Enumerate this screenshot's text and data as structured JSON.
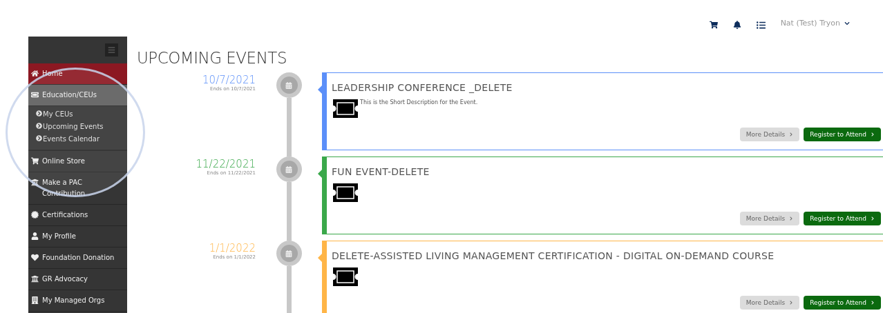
{
  "header": {
    "user": "Nat (Test) Tryon"
  },
  "sidebar": {
    "items": [
      {
        "label": "Home",
        "selected": true,
        "expanded": false
      },
      {
        "label": "Education/CEUs",
        "selected": false,
        "expanded": true,
        "children": [
          {
            "label": "My CEUs"
          },
          {
            "label": "Upcoming Events"
          },
          {
            "label": "Events Calendar"
          }
        ]
      },
      {
        "label": "Online Store",
        "selected": false,
        "expanded": false
      },
      {
        "label": "Make a PAC Contribution",
        "selected": false,
        "expanded": false
      },
      {
        "label": "Certifications",
        "selected": false,
        "expanded": false
      },
      {
        "label": "My Profile",
        "selected": false,
        "expanded": false
      },
      {
        "label": "Foundation Donation",
        "selected": false,
        "expanded": false
      },
      {
        "label": "GR Advocacy",
        "selected": false,
        "expanded": false
      },
      {
        "label": "My Managed Orgs",
        "selected": false,
        "expanded": false
      }
    ]
  },
  "page": {
    "title": "UPCOMING EVENTS"
  },
  "events": [
    {
      "date": "10/7/2021",
      "ends": "Ends on 10/7/2021",
      "color": "#5b8ff9",
      "title": "LEADERSHIP CONFERENCE _DELETE",
      "description": "This is the Short Description for the Event.",
      "more": "More Details",
      "register": "Register to Attend"
    },
    {
      "date": "11/22/2021",
      "ends": "Ends on 11/22/2021",
      "color": "#3aa84a",
      "title": "FUN EVENT-DELETE",
      "more": "More Details",
      "register": "Register to Attend"
    },
    {
      "date": "1/1/2022",
      "ends": "Ends on 1/1/2022",
      "color": "#ffb547",
      "title": "DELETE-ASSISTED LIVING MANAGEMENT CERTIFICATION - DIGITAL ON-DEMAND COURSE",
      "more": "More Details",
      "register": "Register to Attend"
    }
  ]
}
